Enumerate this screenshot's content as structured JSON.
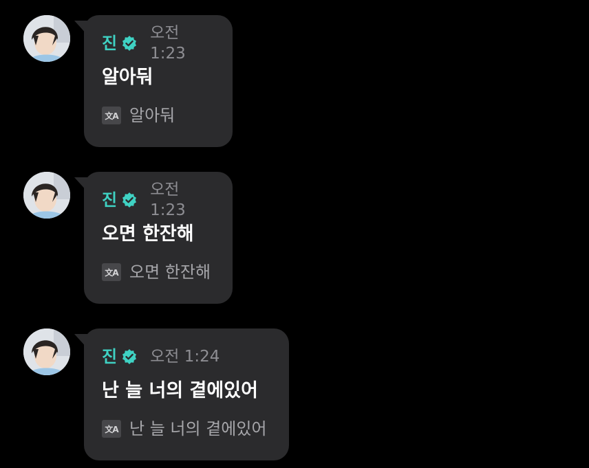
{
  "colors": {
    "background": "#000000",
    "bubble": "#2b2b2d",
    "name": "#3fd2c3",
    "verified_badge": "#3fd2c3",
    "message_text": "#ffffff",
    "time_text": "#8e8e93",
    "translated_text": "#a6a6aa"
  },
  "messages": [
    {
      "sender": "진",
      "verified_icon": "verified-badge-icon",
      "time": "오전 1:23",
      "text": "알아둬",
      "translate_icon": "translate-icon",
      "translation": "알아둬"
    },
    {
      "sender": "진",
      "verified_icon": "verified-badge-icon",
      "time": "오전 1:23",
      "text": "오면 한잔해",
      "translate_icon": "translate-icon",
      "translation": "오면 한잔해"
    },
    {
      "sender": "진",
      "verified_icon": "verified-badge-icon",
      "time": "오전 1:24",
      "text": "난 늘 너의 곁에있어",
      "translate_icon": "translate-icon",
      "translation": "난 늘 너의 곁에있어"
    }
  ]
}
